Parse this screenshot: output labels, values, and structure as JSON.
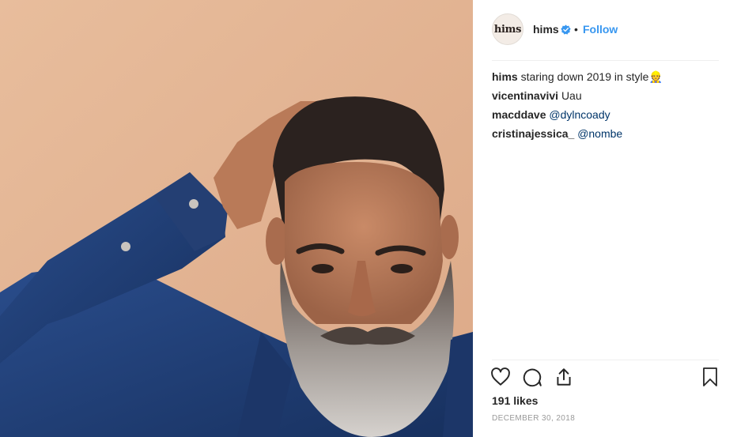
{
  "post": {
    "photo_alt": "hims",
    "header": {
      "avatar_text": "hims",
      "username": "hims",
      "dot": "•",
      "follow_label": "Follow",
      "verified": true
    },
    "comments": [
      {
        "user": "hims",
        "text": "staring down 2019 in style👷",
        "mention": ""
      },
      {
        "user": "vicentinavivi",
        "text": "Uau",
        "mention": ""
      },
      {
        "user": "macddave",
        "text": "",
        "mention": "@dylncoady"
      },
      {
        "user": "cristinajessica_",
        "text": "",
        "mention": "@nombe"
      }
    ],
    "actions": {
      "like_icon": "heart-icon",
      "comment_icon": "comment-icon",
      "share_icon": "share-icon",
      "save_icon": "bookmark-icon"
    },
    "likes": "191 likes",
    "date": "DECEMBER 30, 2018"
  },
  "colors": {
    "link": "#3897f0",
    "mention": "#003569",
    "background_peach": "#e4b593",
    "denim": "#1f3c73"
  }
}
